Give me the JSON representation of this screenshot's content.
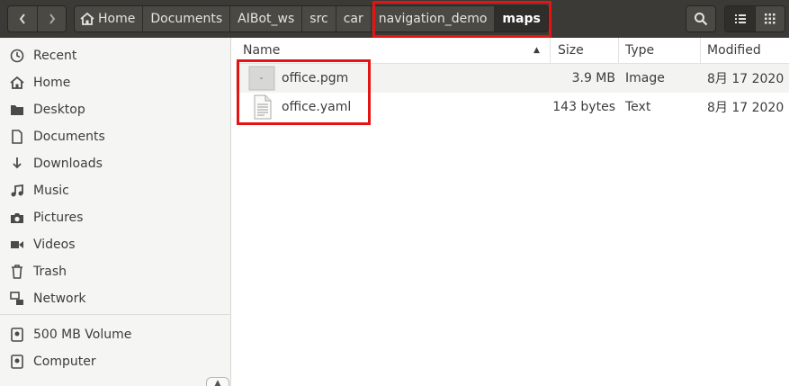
{
  "header": {
    "back_icon": "chevron-left-icon",
    "forward_icon": "chevron-right-icon",
    "breadcrumbs": [
      {
        "label": "Home",
        "icon": "home-icon"
      },
      {
        "label": "Documents"
      },
      {
        "label": "AIBot_ws"
      },
      {
        "label": "src"
      },
      {
        "label": "car"
      },
      {
        "label": "navigation_demo"
      },
      {
        "label": "maps"
      }
    ],
    "search_icon": "search-icon",
    "list_view_icon": "list-view-icon",
    "grid_view_icon": "grid-view-icon"
  },
  "sidebar": {
    "items": [
      {
        "label": "Recent",
        "icon": "clock-icon"
      },
      {
        "label": "Home",
        "icon": "home-icon"
      },
      {
        "label": "Desktop",
        "icon": "folder-icon"
      },
      {
        "label": "Documents",
        "icon": "document-icon"
      },
      {
        "label": "Downloads",
        "icon": "download-icon"
      },
      {
        "label": "Music",
        "icon": "music-icon"
      },
      {
        "label": "Pictures",
        "icon": "camera-icon"
      },
      {
        "label": "Videos",
        "icon": "video-icon"
      },
      {
        "label": "Trash",
        "icon": "trash-icon"
      },
      {
        "label": "Network",
        "icon": "network-icon"
      }
    ],
    "devices": [
      {
        "label": "500 MB Volume",
        "icon": "drive-icon"
      },
      {
        "label": "Computer",
        "icon": "drive-icon"
      }
    ]
  },
  "list": {
    "columns": {
      "name": "Name",
      "size": "Size",
      "type": "Type",
      "modified": "Modified"
    },
    "sort": "ascending",
    "files": [
      {
        "name": "office.pgm",
        "size": "3.9 MB",
        "type": "Image",
        "modified": "8月 17 2020",
        "icon": "image-file-icon"
      },
      {
        "name": "office.yaml",
        "size": "143 bytes",
        "type": "Text",
        "modified": "8月 17 2020",
        "icon": "text-file-icon"
      }
    ]
  },
  "colors": {
    "header_bg": "#3b3a36",
    "highlight": "#e41414",
    "sidebar_bg": "#f5f5f4"
  }
}
